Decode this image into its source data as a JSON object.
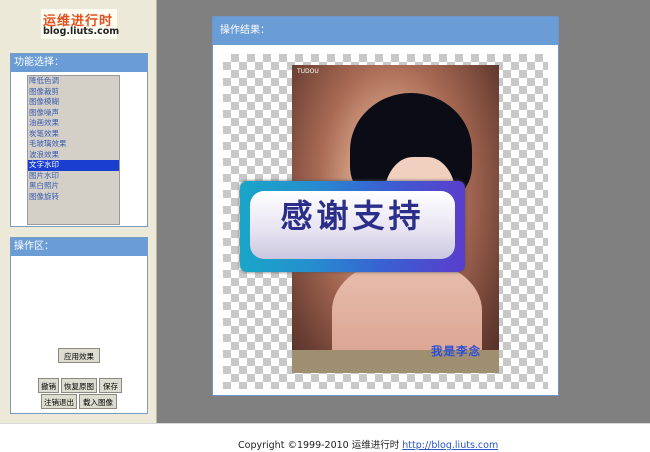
{
  "logo": {
    "title": "运维进行时",
    "subtitle": "blog.liuts.com"
  },
  "function_panel": {
    "title": "功能选择：",
    "items": [
      "降低色调",
      "图像裁剪",
      "图像模糊",
      "图像噪声",
      "油画效果",
      "炭笔效果",
      "毛玻璃效果",
      "波浪效果",
      "文字水印",
      "图片水印",
      "黑白照片",
      "图像旋转"
    ],
    "selected_index": 8
  },
  "operation_panel": {
    "title": "操作区：",
    "apply_label": "应用效果",
    "undo_label": "撤销",
    "restore_label": "恢复原图",
    "save_label": "保存",
    "logout_label": "注销退出",
    "load_label": "载入图像"
  },
  "result_panel": {
    "title": "操作结果：",
    "watermark_text": "感谢支持",
    "photo_caption": "我是李念",
    "photo_mark": "TUDOU"
  },
  "footer": {
    "copyright": "Copyright ©1999-2010 运维进行时",
    "link": "http://blog.liuts.com"
  },
  "colors": {
    "panel_header": "#6a9cd6",
    "selected_item": "#1a3fd0",
    "background": "#808080",
    "sidebar": "#ece9d8"
  }
}
